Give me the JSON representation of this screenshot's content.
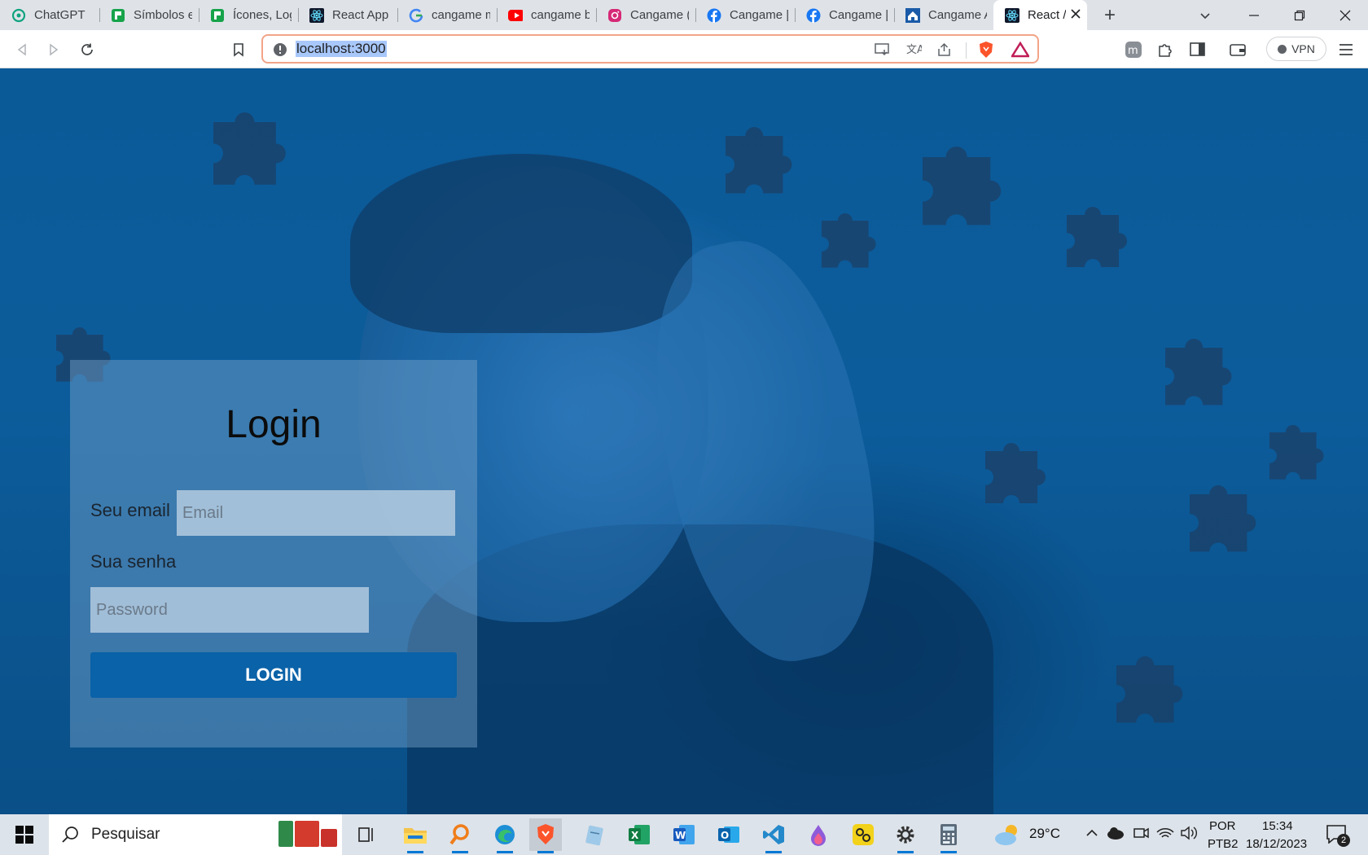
{
  "browser": {
    "tabs": [
      {
        "title": "ChatGPT",
        "icon": "chatgpt-icon",
        "color": "#10a37f"
      },
      {
        "title": "Símbolos e",
        "icon": "green-brand-icon",
        "color": "#16a34a"
      },
      {
        "title": "Ícones, Log",
        "icon": "green-brand-icon",
        "color": "#16a34a"
      },
      {
        "title": "React App",
        "icon": "react-icon",
        "color": "#0f172a"
      },
      {
        "title": "cangame m",
        "icon": "google-icon",
        "color": "#4285f4"
      },
      {
        "title": "cangame b",
        "icon": "youtube-icon",
        "color": "#ff0000"
      },
      {
        "title": "Cangame (",
        "icon": "instagram-icon",
        "color": "#d62976"
      },
      {
        "title": "Cangame |",
        "icon": "facebook-icon",
        "color": "#1877f2"
      },
      {
        "title": "Cangame |",
        "icon": "facebook-icon",
        "color": "#1877f2"
      },
      {
        "title": "Cangame A",
        "icon": "home-icon",
        "color": "#1a5aa8"
      },
      {
        "title": "React /",
        "icon": "react-icon",
        "color": "#0f172a",
        "active": true
      }
    ],
    "new_tab": "+",
    "url": "localhost:3000",
    "vpn_label": "VPN",
    "accent": "#f2a488"
  },
  "login": {
    "title": "Login",
    "email_label": "Seu email",
    "email_placeholder": "Email",
    "password_label": "Sua senha",
    "password_placeholder": "Password",
    "button_label": "LOGIN",
    "button_color": "#0a62a8"
  },
  "taskbar": {
    "search_placeholder": "Pesquisar",
    "weather": "29°C",
    "language": "POR",
    "layout": "PTB2",
    "time": "15:34",
    "date": "18/12/2023",
    "notifications": "2",
    "apps": [
      "task-view-icon",
      "file-explorer-icon",
      "magnifier-app-icon",
      "edge-icon",
      "brave-icon",
      "notepad-icon",
      "excel-icon",
      "word-icon",
      "outlook-icon",
      "vscode-icon",
      "paint-drop-icon",
      "link-app-icon",
      "settings-icon",
      "calculator-icon"
    ]
  }
}
